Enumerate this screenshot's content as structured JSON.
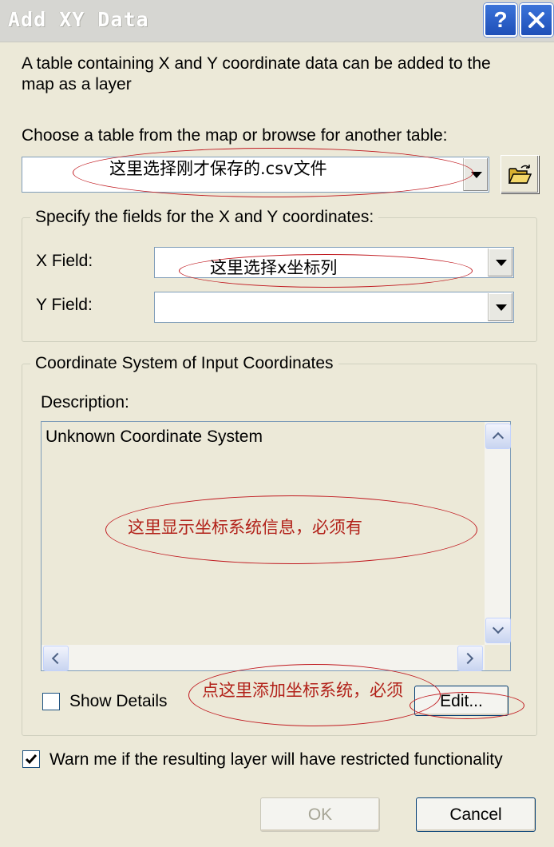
{
  "window": {
    "title": "Add XY Data",
    "help_glyph": "?",
    "close_icon": "close-icon"
  },
  "intro_text": "A table containing X and Y coordinate data can be added to the map as a layer",
  "choose_label": "Choose a table from the map or browse for another table:",
  "table_combo": {
    "value": "",
    "browse_icon": "open-folder-icon"
  },
  "xy_group": {
    "title": "Specify the fields for the X and Y coordinates:",
    "x_label": "X Field:",
    "y_label": "Y Field:",
    "x_value": "",
    "y_value": ""
  },
  "coord_group": {
    "title": "Coordinate System of Input Coordinates",
    "description_label": "Description:",
    "description_text": "Unknown Coordinate System",
    "show_details_label": "Show Details",
    "show_details_checked": false,
    "edit_label": "Edit..."
  },
  "warn": {
    "label": "Warn me if the resulting layer will have restricted functionality",
    "checked": true
  },
  "buttons": {
    "ok": "OK",
    "cancel": "Cancel"
  },
  "annotations": {
    "table_note": "这里选择刚才保存的.csv文件",
    "x_note": "这里选择x坐标列",
    "desc_note": "这里显示坐标系统信息，必须有",
    "edit_note": "点这里添加坐标系统，必须"
  },
  "colors": {
    "dialog_bg": "#ece9d8",
    "annotation_red": "#c0191f",
    "title_blue": "#2458c8"
  }
}
